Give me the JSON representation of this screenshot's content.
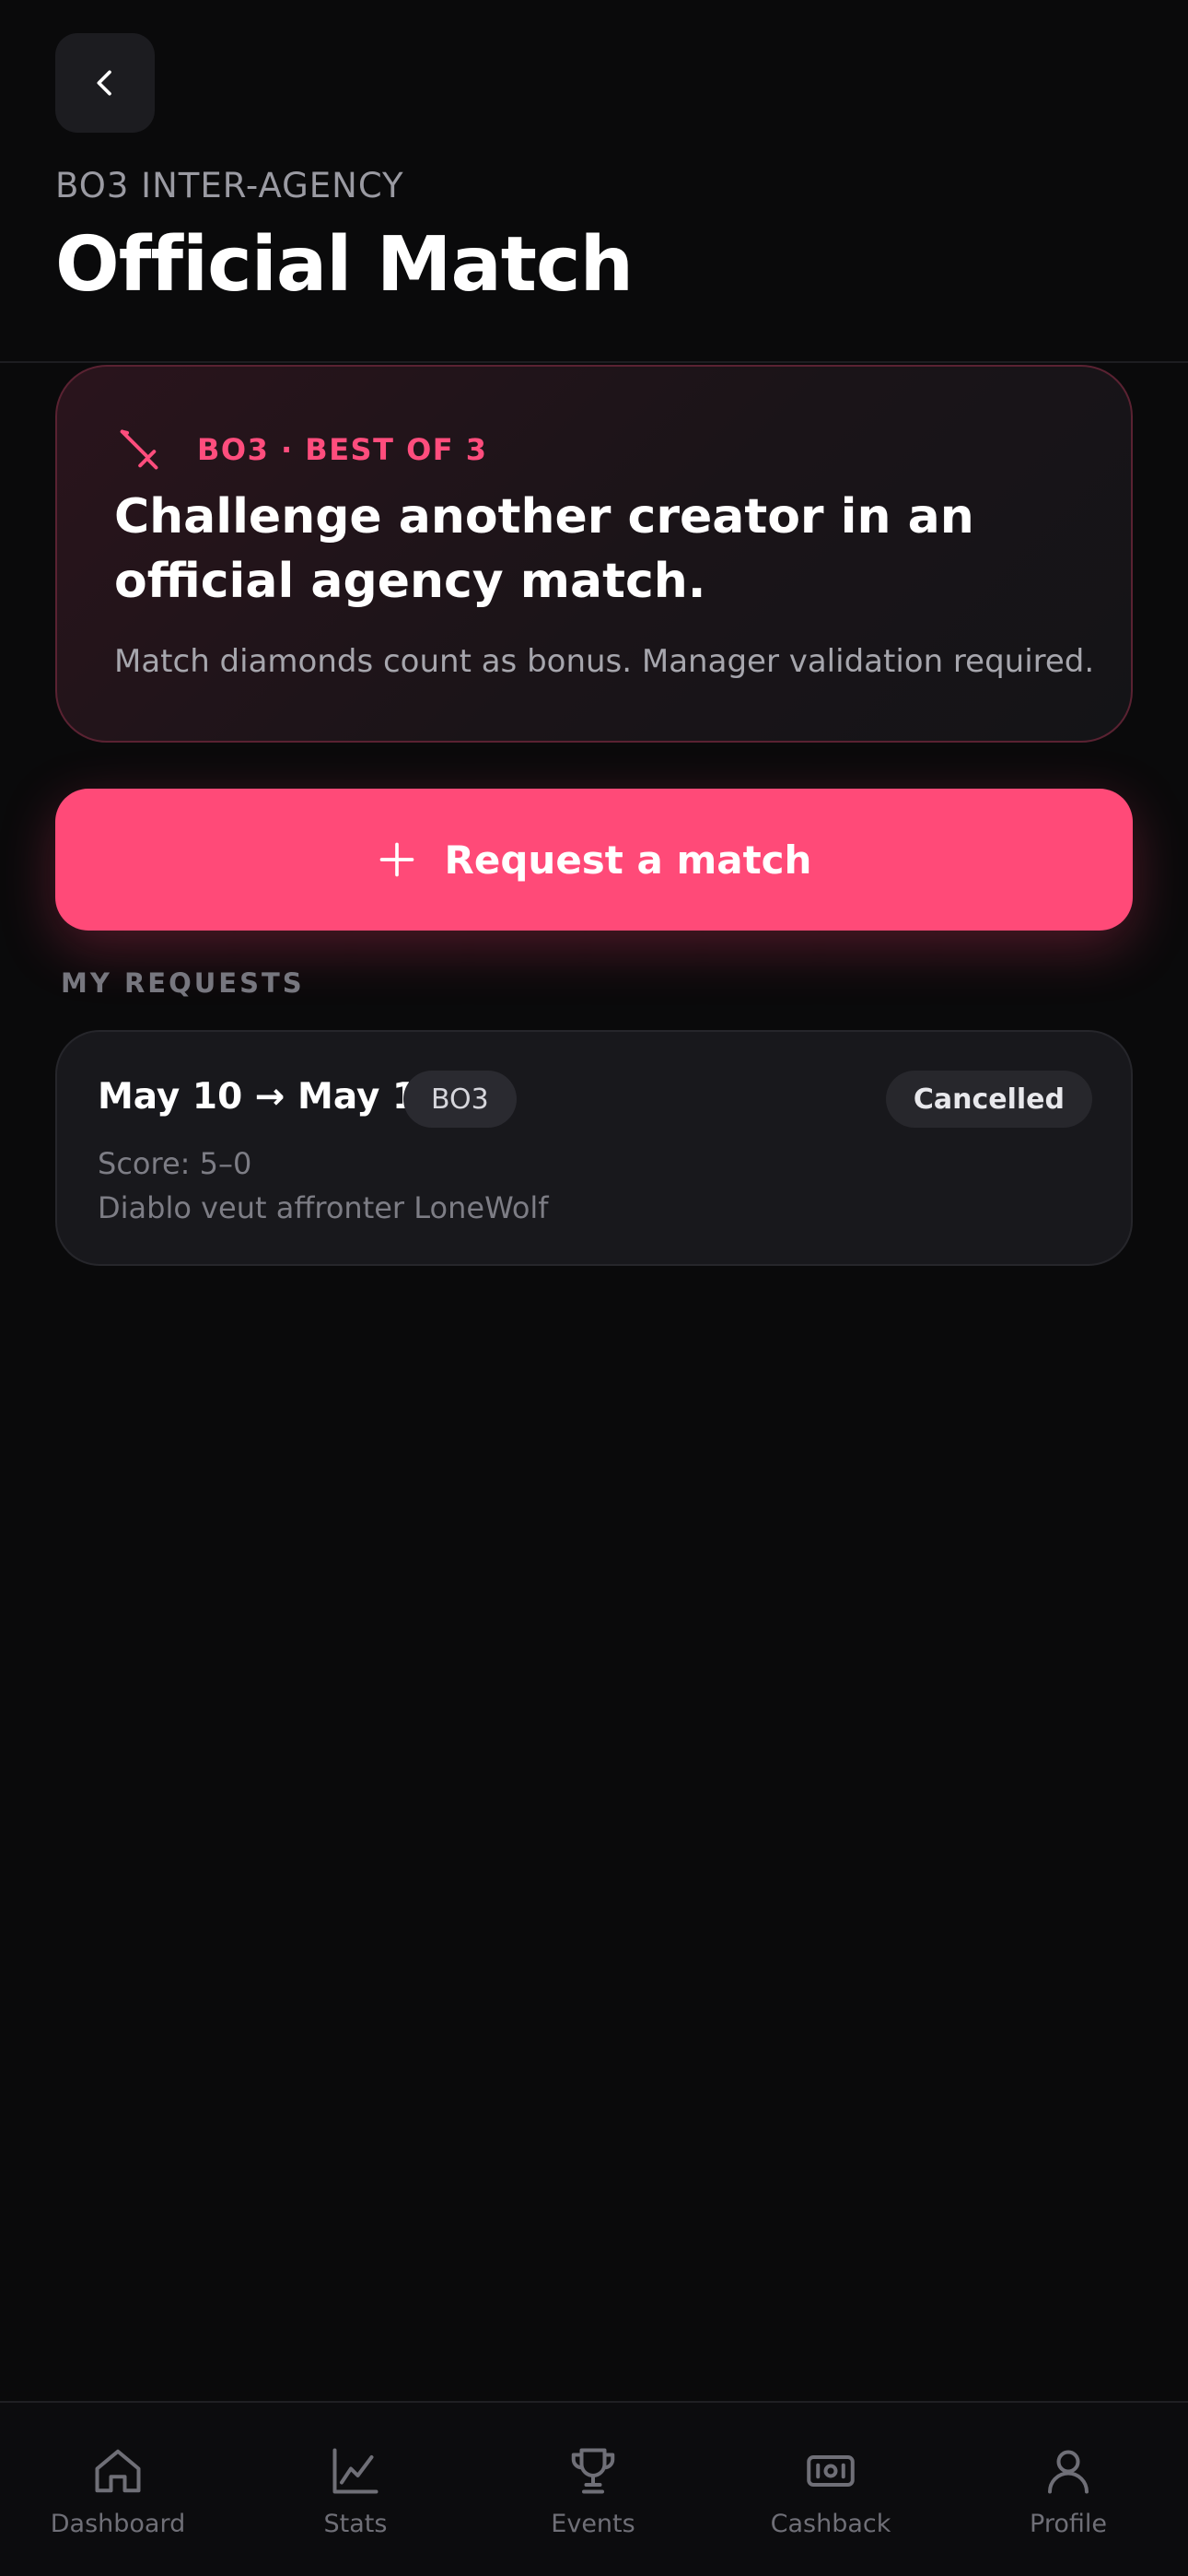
{
  "header": {
    "eyebrow": "BO3 INTER-AGENCY",
    "title": "Official Match",
    "back_icon": "chevron-left-icon"
  },
  "info_card": {
    "icon": "sword-icon",
    "tag": "BO3 · BEST OF 3",
    "headline": "Challenge another creator in an official agency match.",
    "subtext": "Match diamonds count as bonus. Manager validation required."
  },
  "cta": {
    "icon": "plus-icon",
    "label": "Request a match"
  },
  "requests": {
    "section_label": "MY REQUESTS",
    "items": [
      {
        "dates": "May 10 → May 12",
        "type": "BO3",
        "status": "Cancelled",
        "score": "Score: 5–0",
        "description": "Diablo veut affronter LoneWolf"
      }
    ]
  },
  "bottom_nav": {
    "items": [
      {
        "label": "Dashboard",
        "icon": "home-icon"
      },
      {
        "label": "Stats",
        "icon": "chart-line-icon"
      },
      {
        "label": "Events",
        "icon": "trophy-icon"
      },
      {
        "label": "Cashback",
        "icon": "banknote-icon"
      },
      {
        "label": "Profile",
        "icon": "user-icon"
      }
    ]
  },
  "colors": {
    "background": "#0a0a0b",
    "accent": "#ff4a78",
    "accent_text": "#ff4d7d",
    "card": "#18181c",
    "muted_text": "#7d7d85"
  }
}
